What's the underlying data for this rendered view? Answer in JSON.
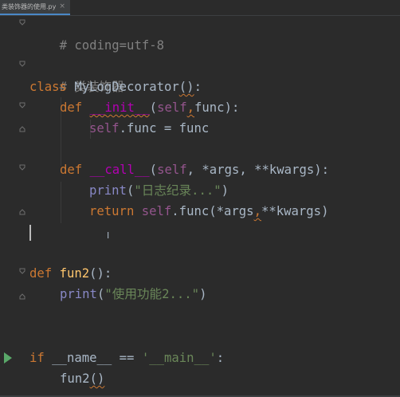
{
  "editor": {
    "tab": {
      "label": "类装饰器的使用.py",
      "close": "×"
    },
    "lines": {
      "l1": {
        "comment": "# coding=utf-8"
      },
      "l3": {
        "comment": "# 类装饰器"
      },
      "l4": {
        "kw": "class",
        "name": "MyLogDecorator",
        "paren": "()",
        "colon": ":"
      },
      "l5": {
        "kw": "def",
        "name": "__init__",
        "open": "(",
        "self": "self",
        "comma": ",",
        "param": "func",
        "close": "):"
      },
      "l6": {
        "self": "self",
        "rest": ".func = func"
      },
      "l8": {
        "kw": "def",
        "name": "__call__",
        "open": "(",
        "self": "self",
        "rest": ", *args, **kwargs):"
      },
      "l9": {
        "call": "print",
        "open": "(",
        "str": "\"日志纪录...\"",
        "close": ")"
      },
      "l10": {
        "kw": "return",
        "self": "self",
        "rest1": ".func(*args",
        "comma": ",",
        "rest2": "**kwargs)"
      },
      "l13": {
        "kw": "def",
        "name": "fun2",
        "rest": "():"
      },
      "l14": {
        "call": "print",
        "open": "(",
        "str": "\"使用功能2...\"",
        "close": ")"
      },
      "l17": {
        "kw": "if",
        "rest1": " __name__ == ",
        "str": "'__main__'",
        "colon": ":"
      },
      "l18": {
        "call": "fun2",
        "paren": "()"
      }
    },
    "run_gutter_icon": "run-icon",
    "cursor_line": 11
  },
  "colors": {
    "background": "#2b2b2b",
    "keyword": "#cc7832",
    "function": "#ffc66d",
    "dunder": "#b200b2",
    "self": "#94558d",
    "string": "#6a8759",
    "comment": "#808080",
    "default": "#a9b7c6",
    "run": "#59a869"
  }
}
